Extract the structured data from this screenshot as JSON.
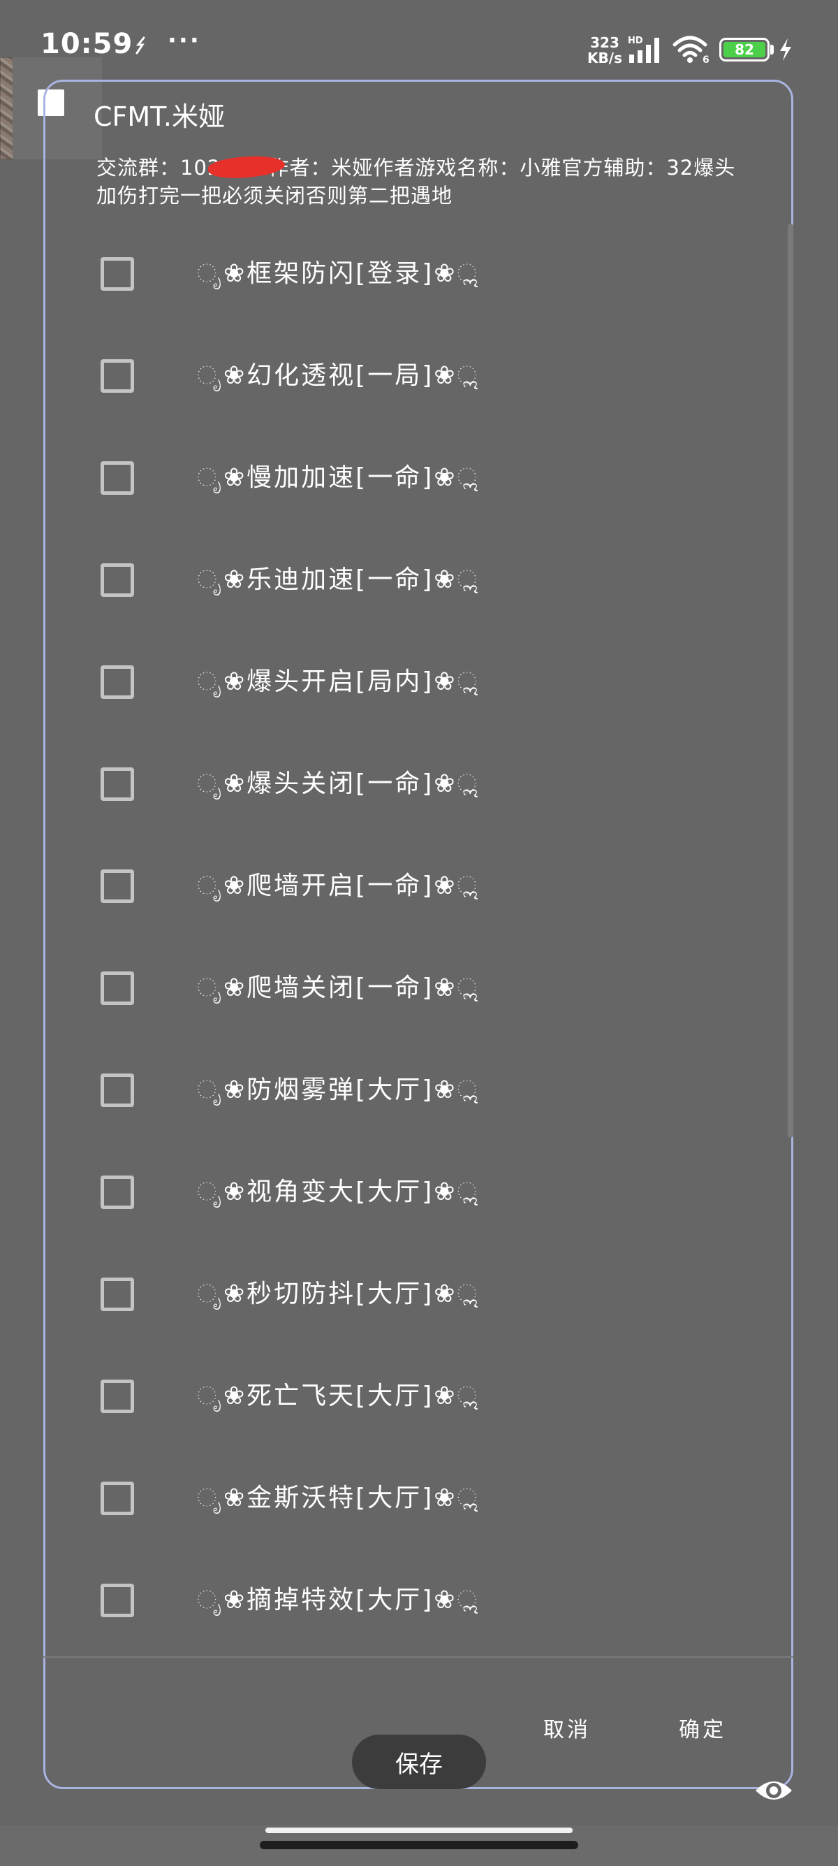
{
  "status_bar": {
    "time": "10:59",
    "more_icon": "···",
    "net_speed_value": "323",
    "net_speed_unit": "KB/s",
    "signal_label": "HD",
    "wifi_label": "6",
    "battery_level": "82"
  },
  "dialog": {
    "title": "CFMT.米娅",
    "info_prefix": "交流群：102",
    "info_rest": "作者：米娅作者游戏名称：小雅官方辅助：32爆头加伤打完一把必须关闭否则第二把遇地",
    "options": [
      {
        "label": "ೃ❀框架防闪[登录]❀ೢ",
        "checked": false
      },
      {
        "label": "ೃ❀幻化透视[一局]❀ೢ",
        "checked": false
      },
      {
        "label": "ೃ❀慢加加速[一命]❀ೢ",
        "checked": false
      },
      {
        "label": "ೃ❀乐迪加速[一命]❀ೢ",
        "checked": false
      },
      {
        "label": "ೃ❀爆头开启[局内]❀ೢ",
        "checked": false
      },
      {
        "label": "ೃ❀爆头关闭[一命]❀ೢ",
        "checked": false
      },
      {
        "label": "ೃ❀爬墙开启[一命]❀ೢ",
        "checked": false
      },
      {
        "label": "ೃ❀爬墙关闭[一命]❀ೢ",
        "checked": false
      },
      {
        "label": "ೃ❀防烟雾弹[大厅]❀ೢ",
        "checked": false
      },
      {
        "label": "ೃ❀视角变大[大厅]❀ೢ",
        "checked": false
      },
      {
        "label": "ೃ❀秒切防抖[大厅]❀ೢ",
        "checked": false
      },
      {
        "label": "ೃ❀死亡飞天[大厅]❀ೢ",
        "checked": false
      },
      {
        "label": "ೃ❀金斯沃特[大厅]❀ೢ",
        "checked": false
      },
      {
        "label": "ೃ❀摘掉特效[大厅]❀ೢ",
        "checked": false
      }
    ],
    "cancel_label": "取消",
    "confirm_label": "确定"
  },
  "save_label": "保存",
  "colors": {
    "background": "#666666",
    "dialog_border": "#a9b4e0",
    "battery": "#4cd04a",
    "redaction": "#e7302a",
    "save_button": "#3c3c3c"
  },
  "icons": {
    "floating": "app-thumbnail-icon",
    "eye": "eye-icon",
    "wifi": "wifi-icon",
    "signal": "signal-icon",
    "charge": "bolt-icon"
  }
}
